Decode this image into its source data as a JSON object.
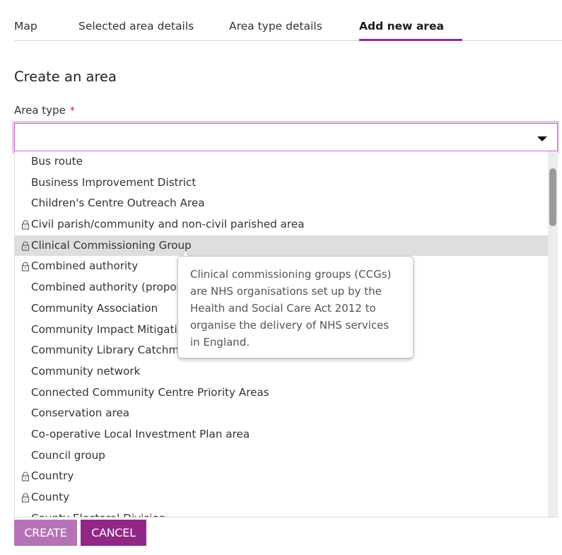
{
  "tabs": [
    {
      "label": "Map",
      "active": false
    },
    {
      "label": "Selected area details",
      "active": false
    },
    {
      "label": "Area type details",
      "active": false
    },
    {
      "label": "Add new area",
      "active": true
    }
  ],
  "accent_color": "#922a8d",
  "heading": "Create an area",
  "area_type_field": {
    "label": "Area type",
    "required_marker": "*",
    "value": "",
    "caret_icon": "caret-down-icon"
  },
  "dropdown": {
    "highlighted_index": 4,
    "options": [
      {
        "label": "Bus route",
        "locked": false
      },
      {
        "label": "Business Improvement District",
        "locked": false
      },
      {
        "label": "Children's Centre Outreach Area",
        "locked": false
      },
      {
        "label": "Civil parish/community and non-civil parished area",
        "locked": true
      },
      {
        "label": "Clinical Commissioning Group",
        "locked": true
      },
      {
        "label": "Combined authority",
        "locked": true
      },
      {
        "label": "Combined authority (proposed)",
        "locked": false
      },
      {
        "label": "Community Association",
        "locked": false
      },
      {
        "label": "Community Impact Mitigation",
        "locked": false
      },
      {
        "label": "Community Library Catchment",
        "locked": false
      },
      {
        "label": "Community network",
        "locked": false
      },
      {
        "label": "Connected Community Centre Priority Areas",
        "locked": false
      },
      {
        "label": "Conservation area",
        "locked": false
      },
      {
        "label": "Co-operative Local Investment Plan area",
        "locked": false
      },
      {
        "label": "Council group",
        "locked": false
      },
      {
        "label": "Country",
        "locked": true
      },
      {
        "label": "County",
        "locked": true
      },
      {
        "label": "County Electoral Division",
        "locked": false
      }
    ]
  },
  "tooltip": {
    "text": "Clinical commissioning groups (CCGs) are NHS organisations set up by the Health and Social Care Act 2012 to organise the delivery of NHS services in England."
  },
  "buttons": {
    "create": "CREATE",
    "cancel": "CANCEL"
  }
}
